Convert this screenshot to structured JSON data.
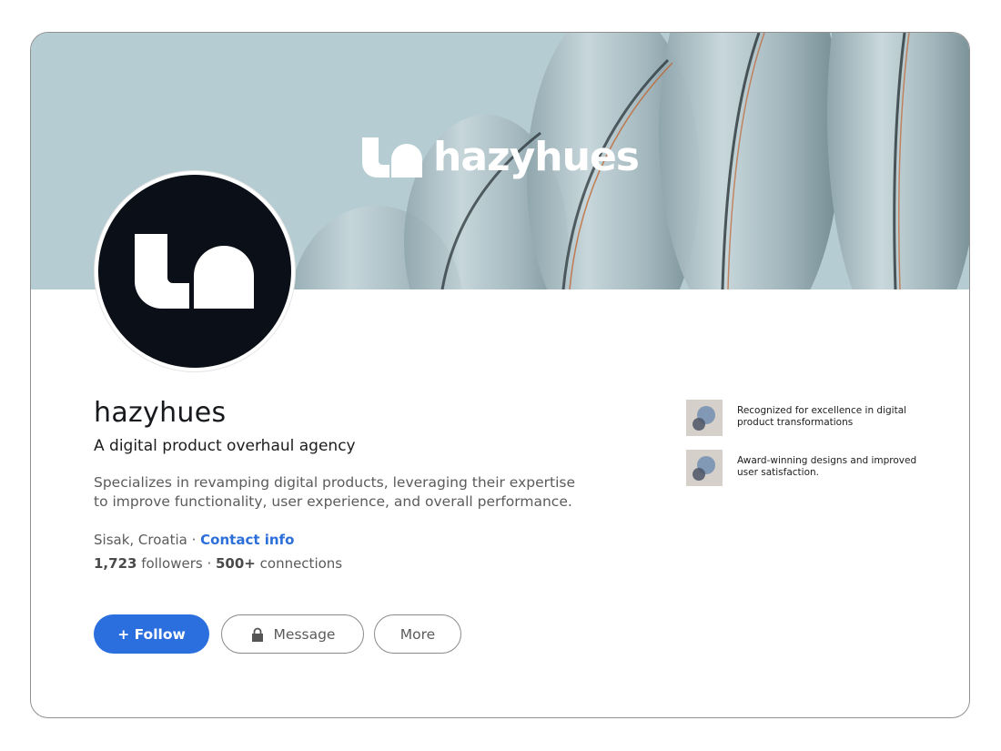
{
  "banner": {
    "wordmark": "hazyhues",
    "colors": {
      "background": "#b6ccd3",
      "logo": "#ffffff"
    }
  },
  "avatar": {
    "icon": "hazyhues-logo-icon",
    "background": "#0b0f17"
  },
  "profile": {
    "name": "hazyhues",
    "tagline": "A digital product overhaul agency",
    "description": "Specializes in revamping digital products, leveraging their expertise to improve functionality, user experience, and overall performance.",
    "location": "Sisak, Croatia",
    "separator": " · ",
    "contact_label": "Contact info",
    "followers_count": "1,723",
    "followers_label": " followers",
    "connections_count": "500+",
    "connections_label": " connections"
  },
  "actions": {
    "follow_label": "+ Follow",
    "message_label": "Message",
    "more_label": "More"
  },
  "awards": [
    {
      "icon": "award-thumbnail-icon",
      "text": "Recognized for excellence in digital product transformations"
    },
    {
      "icon": "award-thumbnail-icon",
      "text": "Award-winning designs and improved user satisfaction."
    }
  ],
  "colors": {
    "accent": "#2b6fde",
    "link": "#2d6fd8",
    "text_primary": "#17191c",
    "text_secondary": "#5b5b5b"
  }
}
